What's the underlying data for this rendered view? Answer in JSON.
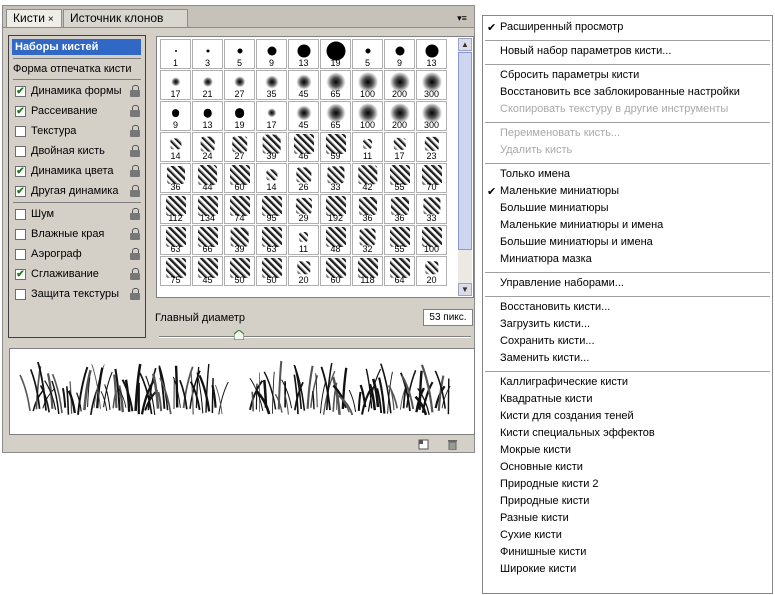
{
  "panel": {
    "tabs": [
      {
        "label": "Кисти",
        "close": "×"
      },
      {
        "label": "Источник клонов"
      }
    ],
    "menu_icon": "panel-menu-icon",
    "left_list": {
      "presets": "Наборы кистей",
      "tip_shape": "Форма отпечатка кисти",
      "options": [
        {
          "label": "Динамика формы",
          "checked": true
        },
        {
          "label": "Рассеивание",
          "checked": true
        },
        {
          "label": "Текстура",
          "checked": false
        },
        {
          "label": "Двойная кисть",
          "checked": false
        },
        {
          "label": "Динамика цвета",
          "checked": true
        },
        {
          "label": "Другая динамика",
          "checked": true
        },
        {
          "label": "Шум",
          "checked": false
        },
        {
          "label": "Влажные края",
          "checked": false
        },
        {
          "label": "Аэрограф",
          "checked": false
        },
        {
          "label": "Сглаживание",
          "checked": true
        },
        {
          "label": "Защита текстуры",
          "checked": false
        }
      ]
    },
    "brush_sizes": [
      [
        "1",
        "3",
        "5",
        "9",
        "13",
        "19",
        "5",
        "9",
        "13"
      ],
      [
        "17",
        "21",
        "27",
        "35",
        "45",
        "65",
        "100",
        "200",
        "300"
      ],
      [
        "9",
        "13",
        "19",
        "17",
        "45",
        "65",
        "100",
        "200",
        "300"
      ],
      [
        "14",
        "24",
        "27",
        "39",
        "46",
        "59",
        "11",
        "17",
        "23"
      ],
      [
        "36",
        "44",
        "60",
        "14",
        "26",
        "33",
        "42",
        "55",
        "70"
      ],
      [
        "112",
        "134",
        "74",
        "95",
        "29",
        "192",
        "36",
        "36",
        "33"
      ],
      [
        "63",
        "66",
        "39",
        "63",
        "11",
        "48",
        "32",
        "55",
        "100"
      ],
      [
        "75",
        "45",
        "50",
        "50",
        "20",
        "60",
        "118",
        "64",
        "20"
      ]
    ],
    "diameter_label": "Главный диаметр",
    "diameter_value": "53 пикс."
  },
  "menu": {
    "items": [
      {
        "label": "Расширенный просмотр",
        "checked": true
      },
      {
        "sep": true
      },
      {
        "label": "Новый набор параметров кисти..."
      },
      {
        "sep": true
      },
      {
        "label": "Сбросить параметры кисти"
      },
      {
        "label": "Восстановить все заблокированные настройки"
      },
      {
        "label": "Скопировать текстуру в другие инструменты",
        "disabled": true
      },
      {
        "sep": true
      },
      {
        "label": "Переименовать кисть...",
        "disabled": true
      },
      {
        "label": "Удалить кисть",
        "disabled": true
      },
      {
        "sep": true
      },
      {
        "label": "Только имена"
      },
      {
        "label": "Маленькие миниатюры",
        "checked": true
      },
      {
        "label": "Большие миниатюры"
      },
      {
        "label": "Маленькие миниатюры и имена"
      },
      {
        "label": "Большие миниатюры и имена"
      },
      {
        "label": "Миниатюра мазка"
      },
      {
        "sep": true
      },
      {
        "label": "Управление наборами..."
      },
      {
        "sep": true
      },
      {
        "label": "Восстановить кисти..."
      },
      {
        "label": "Загрузить кисти..."
      },
      {
        "label": "Сохранить кисти..."
      },
      {
        "label": "Заменить кисти..."
      },
      {
        "sep": true
      },
      {
        "label": "Каллиграфические кисти"
      },
      {
        "label": "Квадратные кисти"
      },
      {
        "label": "Кисти для создания теней"
      },
      {
        "label": "Кисти специальных эффектов"
      },
      {
        "label": "Мокрые кисти"
      },
      {
        "label": "Основные кисти"
      },
      {
        "label": "Природные кисти 2"
      },
      {
        "label": "Природные кисти"
      },
      {
        "label": "Разные кисти"
      },
      {
        "label": "Сухие кисти"
      },
      {
        "label": "Финишные кисти"
      },
      {
        "label": "Широкие кисти"
      }
    ]
  }
}
